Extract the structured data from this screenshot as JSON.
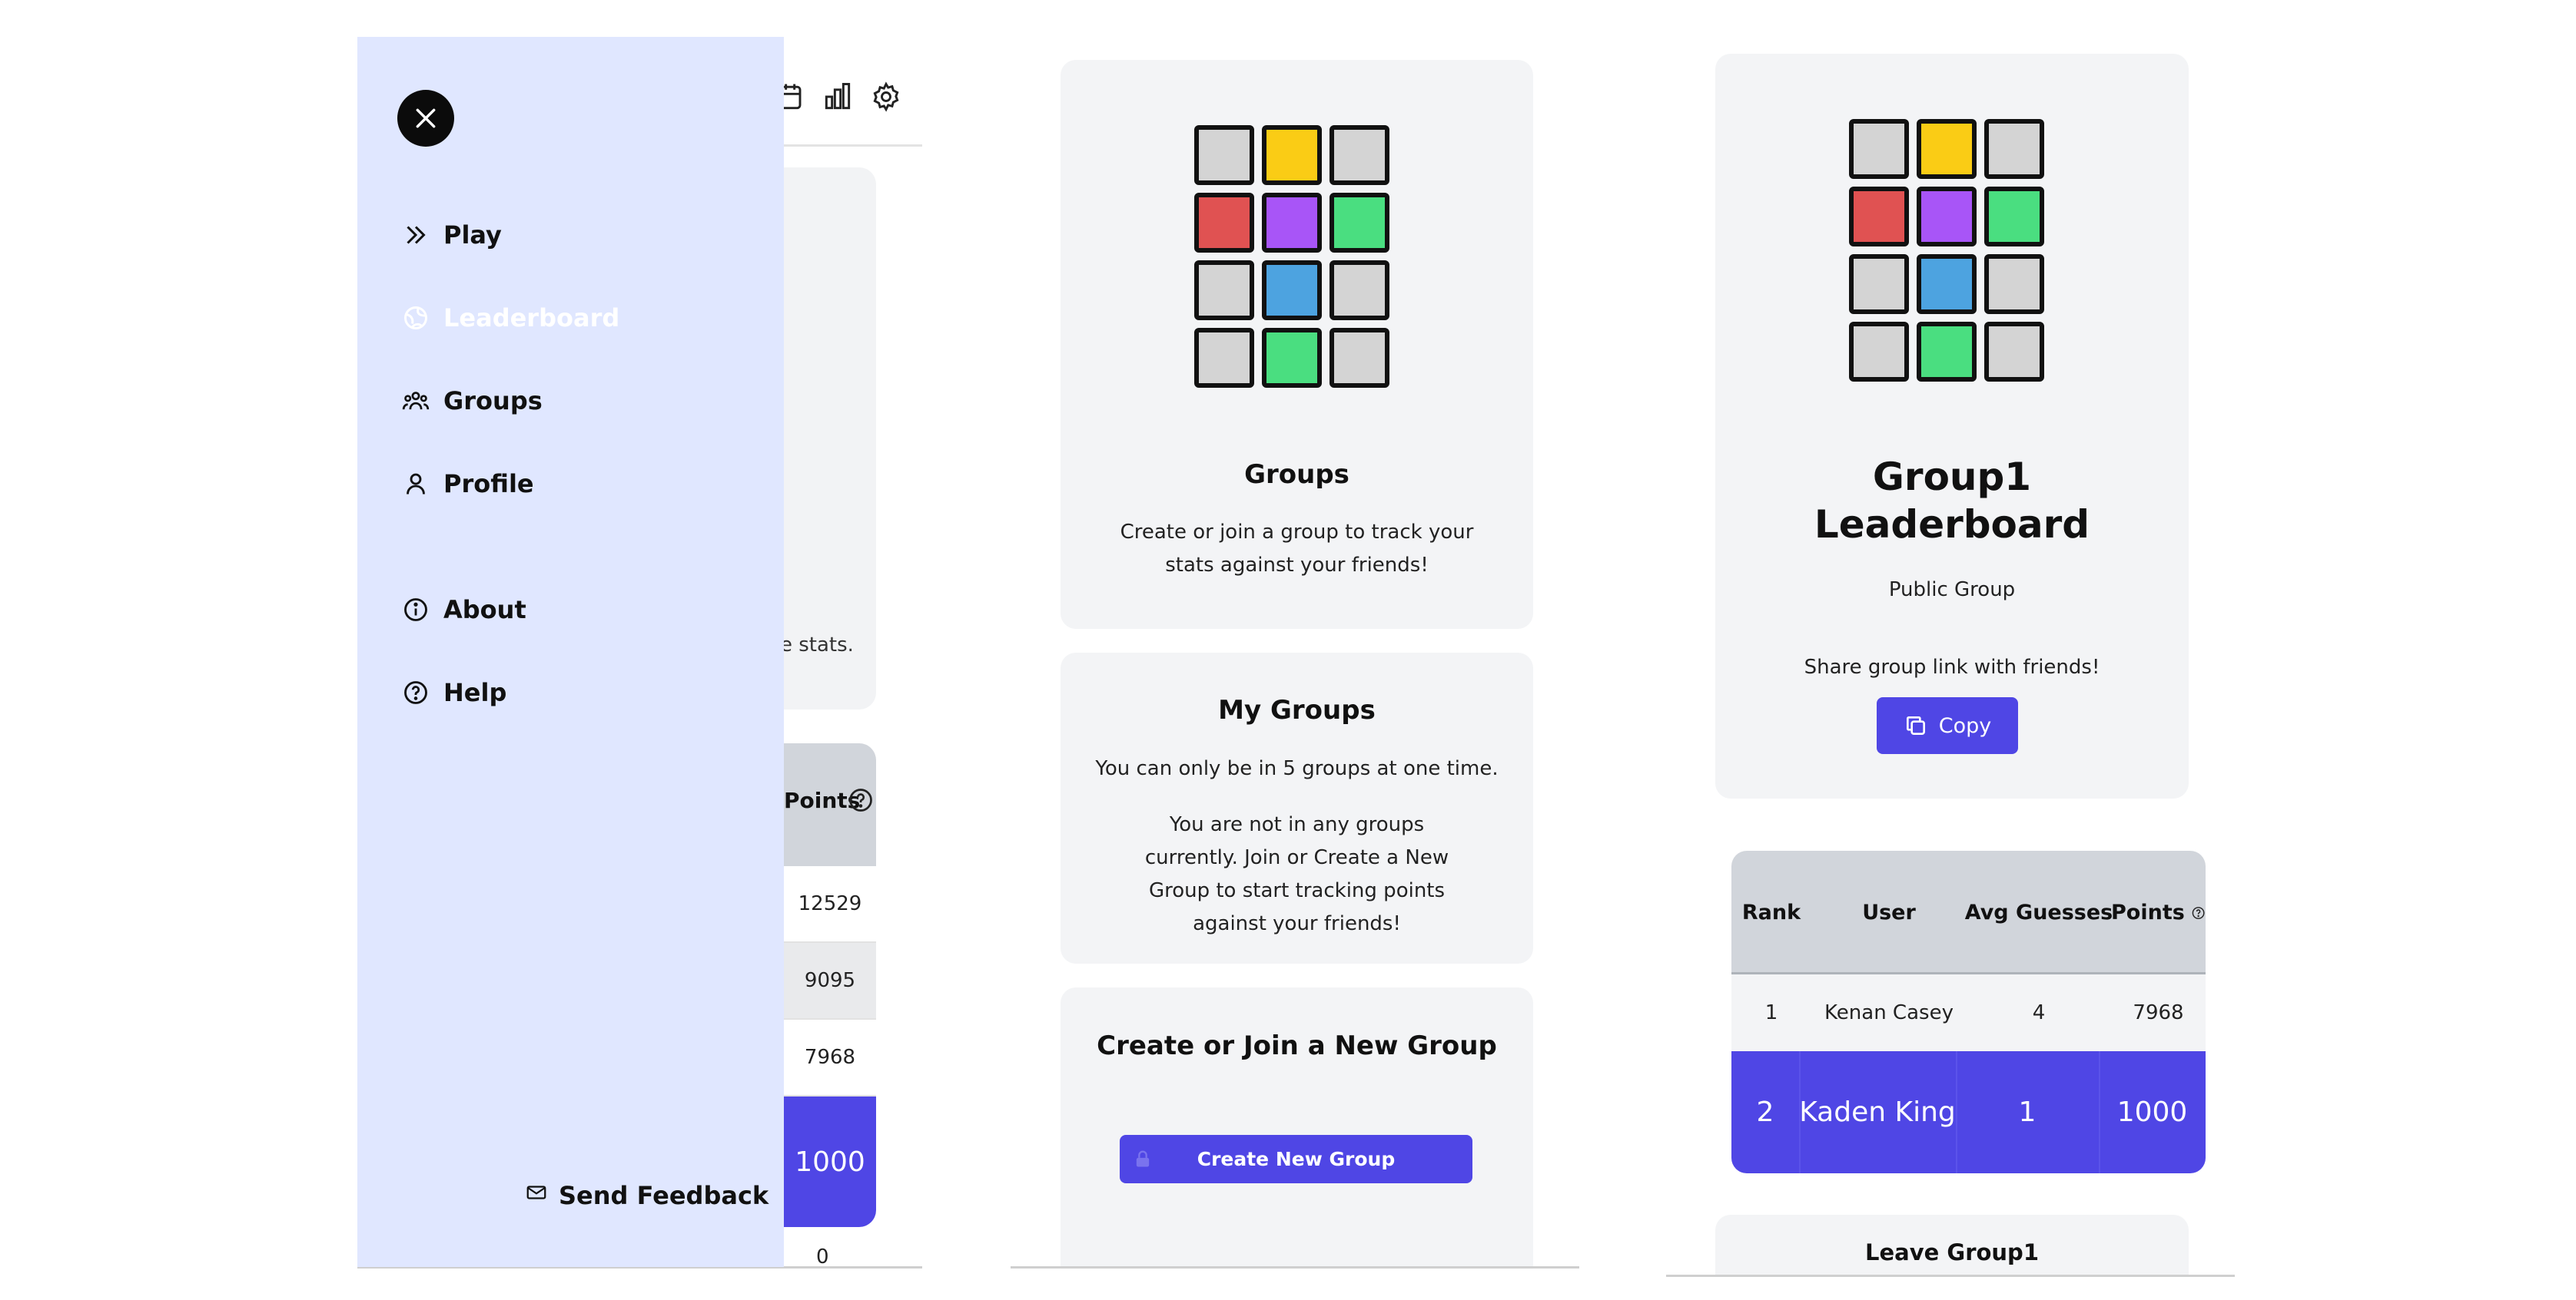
{
  "colors": {
    "accent": "#4f46e5",
    "drawer_bg": "#e0e7ff",
    "card_bg": "#f3f4f6",
    "tile_gray": "#d4d4d4",
    "tile_yellow": "#facc15",
    "tile_red": "#e05252",
    "tile_purple": "#a855f7",
    "tile_green": "#4ade80",
    "tile_blue": "#4da3e0"
  },
  "logo_tiles": [
    "gray",
    "yellow",
    "gray",
    "red",
    "purple",
    "green",
    "gray",
    "blue",
    "gray",
    "gray",
    "green",
    "gray"
  ],
  "drawer": {
    "close_icon": "close-icon",
    "items": [
      {
        "label": "Play",
        "icon": "chevrons-right-icon"
      },
      {
        "label": "Leaderboard",
        "icon": "globe-icon"
      },
      {
        "label": "Groups",
        "icon": "users-icon"
      },
      {
        "label": "Profile",
        "icon": "user-icon"
      },
      {
        "label": "About",
        "icon": "info-icon"
      },
      {
        "label": "Help",
        "icon": "help-circle-icon"
      }
    ],
    "feedback_label": "Send Feedback",
    "feedback_icon": "mail-icon"
  },
  "behind": {
    "topbar_icons": [
      "calendar-icon",
      "bar-chart-icon",
      "gear-icon"
    ],
    "stats_fragment": "e stats.",
    "points_header": "Points",
    "points_values": [
      "12529",
      "9095",
      "7968",
      "1000",
      "0"
    ]
  },
  "groups_page": {
    "title": "Groups",
    "subtitle": "Create or join a group to track your stats against your friends!",
    "my_groups_title": "My Groups",
    "my_groups_limit": "You can only be in 5 groups at one time.",
    "my_groups_empty": "You are not in any groups currently. Join or Create a New Group to start tracking points against your friends!",
    "create_join_title": "Create or Join a New Group",
    "create_button_label": "Create New Group",
    "create_button_icon": "lock-icon"
  },
  "leaderboard_page": {
    "title_line1": "Group1",
    "title_line2": "Leaderboard",
    "visibility": "Public Group",
    "share_text": "Share group link with friends!",
    "copy_label": "Copy",
    "copy_icon": "copy-icon",
    "columns": [
      "Rank",
      "User",
      "Avg Guesses",
      "Points"
    ],
    "rows": [
      {
        "rank": "1",
        "user": "Kenan Casey",
        "avg_guesses": "4",
        "points": "7968"
      },
      {
        "rank": "2",
        "user": "Kaden King",
        "avg_guesses": "1",
        "points": "1000"
      }
    ],
    "leave_label": "Leave Group1"
  }
}
